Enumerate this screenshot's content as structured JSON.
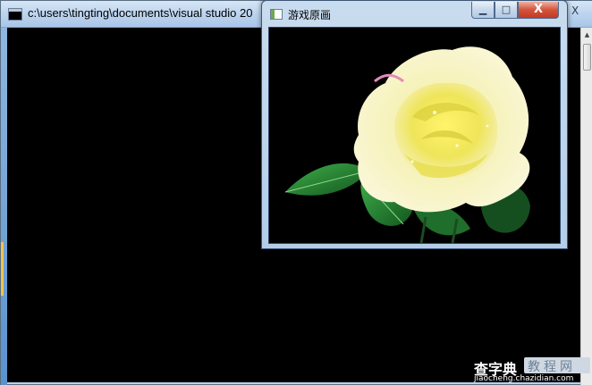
{
  "console_window": {
    "title": "c:\\users\\tingting\\documents\\visual studio 20",
    "close_glyph": "X"
  },
  "image_window": {
    "title": "游戏原画",
    "controls": {
      "minimize": "▁",
      "maximize": "□",
      "close": "X"
    },
    "image": "yellow rose with green leaves on black background"
  },
  "watermark": {
    "main": "查字典",
    "sub": "教程网",
    "url": "jiaocheng.chazidian.com"
  },
  "colors": {
    "console_background": "#000000",
    "titlebar": "#bcd4ee",
    "close_button": "#c23a22",
    "rose": "#f2e85a",
    "leaf": "#2e8b3a"
  }
}
